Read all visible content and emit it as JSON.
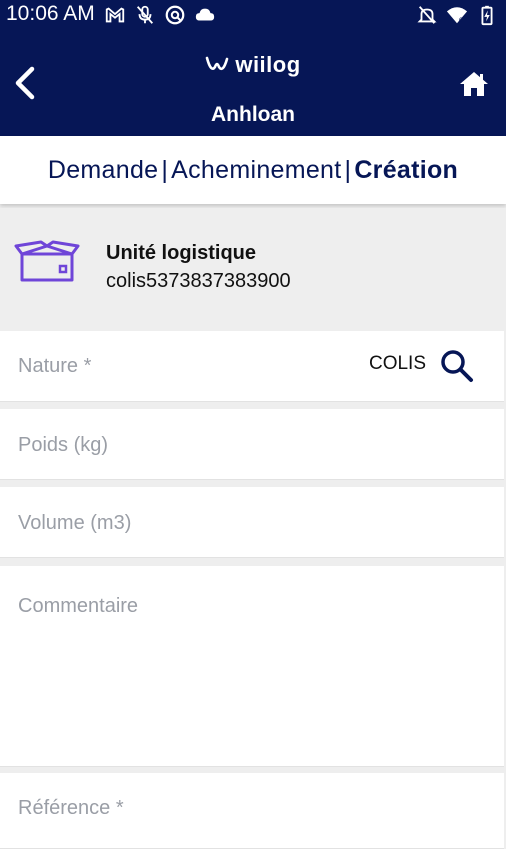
{
  "status_bar": {
    "time": "10:06 AM",
    "left_icons": [
      "gmail-icon",
      "mic-off-icon",
      "vpn-icon",
      "cloud-icon"
    ],
    "right_icons": [
      "notifications-off-icon",
      "wifi-6-icon",
      "battery-charging-icon"
    ]
  },
  "header": {
    "logo_text": "wiilog",
    "title": "Anhloan",
    "background": "#061656"
  },
  "steps": {
    "items": [
      "Demande",
      "Acheminement",
      "Création"
    ],
    "separator": "|",
    "active_index": 2
  },
  "logistic_unit": {
    "label": "Unité logistique",
    "value": "colis5373837383900",
    "icon": "package-box-icon",
    "icon_color": "#6f45d8"
  },
  "form": {
    "nature": {
      "label": "Nature *",
      "value": "COLIS"
    },
    "weight": {
      "label": "Poids (kg)"
    },
    "volume": {
      "label": "Volume (m3)"
    },
    "comment": {
      "label": "Commentaire"
    },
    "reference": {
      "label": "Référence *"
    }
  }
}
